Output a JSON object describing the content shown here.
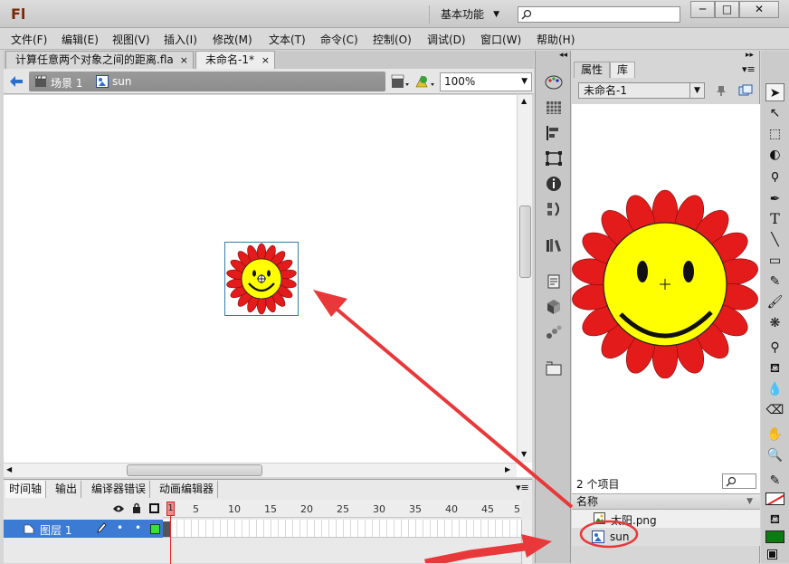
{
  "app": {
    "logo": "Fl",
    "workspace": "基本功能",
    "search_placeholder": ""
  },
  "window_controls": {
    "minimize": "─",
    "maximize": "□",
    "close": "✕"
  },
  "menu": [
    "文件(F)",
    "编辑(E)",
    "视图(V)",
    "插入(I)",
    "修改(M)",
    "文本(T)",
    "命令(C)",
    "控制(O)",
    "调试(D)",
    "窗口(W)",
    "帮助(H)"
  ],
  "doc_tabs": [
    {
      "label": "计算任意两个对象之间的距离.fla",
      "close": "×",
      "active": false
    },
    {
      "label": "未命名-1*",
      "close": "×",
      "active": true
    }
  ],
  "edit_bar": {
    "scene": "场景 1",
    "symbol": "sun",
    "zoom": "100%"
  },
  "timeline": {
    "tabs": [
      "时间轴",
      "输出",
      "编译器错误",
      "动画编辑器"
    ],
    "frame_numbers": [
      "1",
      "5",
      "10",
      "15",
      "20",
      "25",
      "30",
      "35",
      "40",
      "45",
      "5"
    ],
    "layer_name": "图层 1",
    "current_frame": "1"
  },
  "library": {
    "tabs": [
      "属性",
      "库"
    ],
    "document": "未命名-1",
    "item_count": "2 个项目",
    "column_header": "名称",
    "items": [
      {
        "name": "太阳.png",
        "icon": "bitmap-icon"
      },
      {
        "name": "sun",
        "icon": "graphic-symbol-icon"
      }
    ]
  },
  "colors": {
    "selected_layer": "#3c7bd4",
    "arrow": "#e8383a",
    "stroke_swatch": "#000000",
    "fill_swatch": "#0d7a12",
    "sun_petal": "#e31b1b",
    "sun_face": "#ffff00"
  }
}
